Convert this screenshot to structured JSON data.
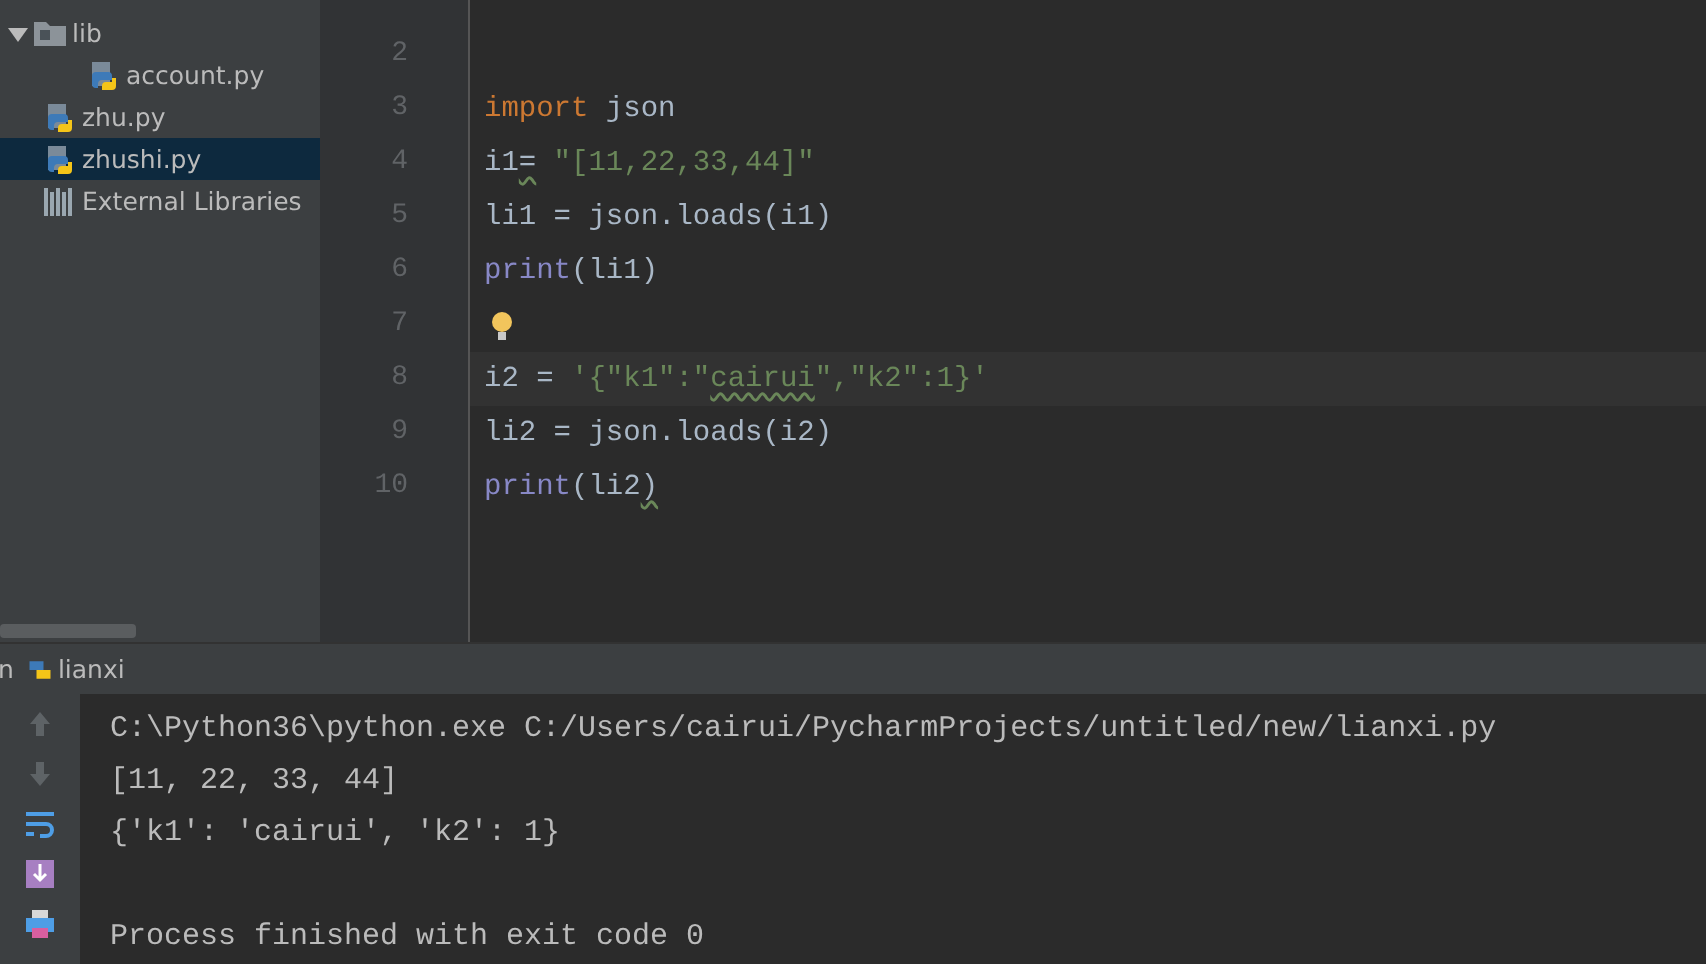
{
  "project_tree": [
    {
      "label": "lib",
      "kind": "folder",
      "expanded": true,
      "selected": false,
      "children": [
        {
          "label": "account.py",
          "kind": "python",
          "selected": false
        }
      ]
    },
    {
      "label": "zhu.py",
      "kind": "python",
      "selected": false
    },
    {
      "label": "zhushi.py",
      "kind": "python",
      "selected": true
    },
    {
      "label": "External Libraries",
      "kind": "library",
      "selected": false
    }
  ],
  "editor": {
    "lines": [
      {
        "number": "2"
      },
      {
        "number": "3",
        "tokens": [
          {
            "text": "import",
            "kind": "keyword"
          },
          {
            "text": " json",
            "kind": "plain"
          }
        ]
      },
      {
        "number": "4",
        "tokens": [
          {
            "text": "i1",
            "kind": "plain"
          },
          {
            "text": "=",
            "kind": "plain",
            "warning": true
          },
          {
            "text": " \"[11,22,33,44]\"",
            "kind": "string"
          }
        ]
      },
      {
        "number": "5",
        "tokens": [
          {
            "text": "li1 = json.loads(i1)",
            "kind": "plain"
          }
        ]
      },
      {
        "number": "6",
        "tokens": [
          {
            "text": "print",
            "kind": "builtin"
          },
          {
            "text": "(li1)",
            "kind": "plain"
          }
        ]
      },
      {
        "number": "7",
        "bulb": true
      },
      {
        "number": "8",
        "current": true,
        "tokens": [
          {
            "text": "i2 = ",
            "kind": "plain"
          },
          {
            "text": "'{\"k1\":\"",
            "kind": "string"
          },
          {
            "text": "cairui",
            "kind": "string",
            "warning": true
          },
          {
            "text": "\",\"k2\":1}'",
            "kind": "string"
          }
        ]
      },
      {
        "number": "9",
        "tokens": [
          {
            "text": "li2 = json.loads(i2)",
            "kind": "plain"
          }
        ]
      },
      {
        "number": "10",
        "tokens": [
          {
            "text": "print",
            "kind": "builtin"
          },
          {
            "text": "(li2",
            "kind": "plain"
          },
          {
            "text": ")",
            "kind": "plain",
            "warning": true
          }
        ]
      }
    ]
  },
  "run_panel": {
    "title_cut": "n",
    "tab": "lianxi",
    "toolbar": [
      {
        "kind": "up"
      },
      {
        "kind": "down"
      },
      {
        "kind": "wrap"
      },
      {
        "kind": "scroll-end"
      },
      {
        "kind": "print"
      }
    ],
    "output": [
      "C:\\Python36\\python.exe C:/Users/cairui/PycharmProjects/untitled/new/lianxi.py",
      "[11, 22, 33, 44]",
      "{'k1': 'cairui', 'k2': 1}"
    ],
    "exit_message": "Process finished with exit code 0"
  }
}
